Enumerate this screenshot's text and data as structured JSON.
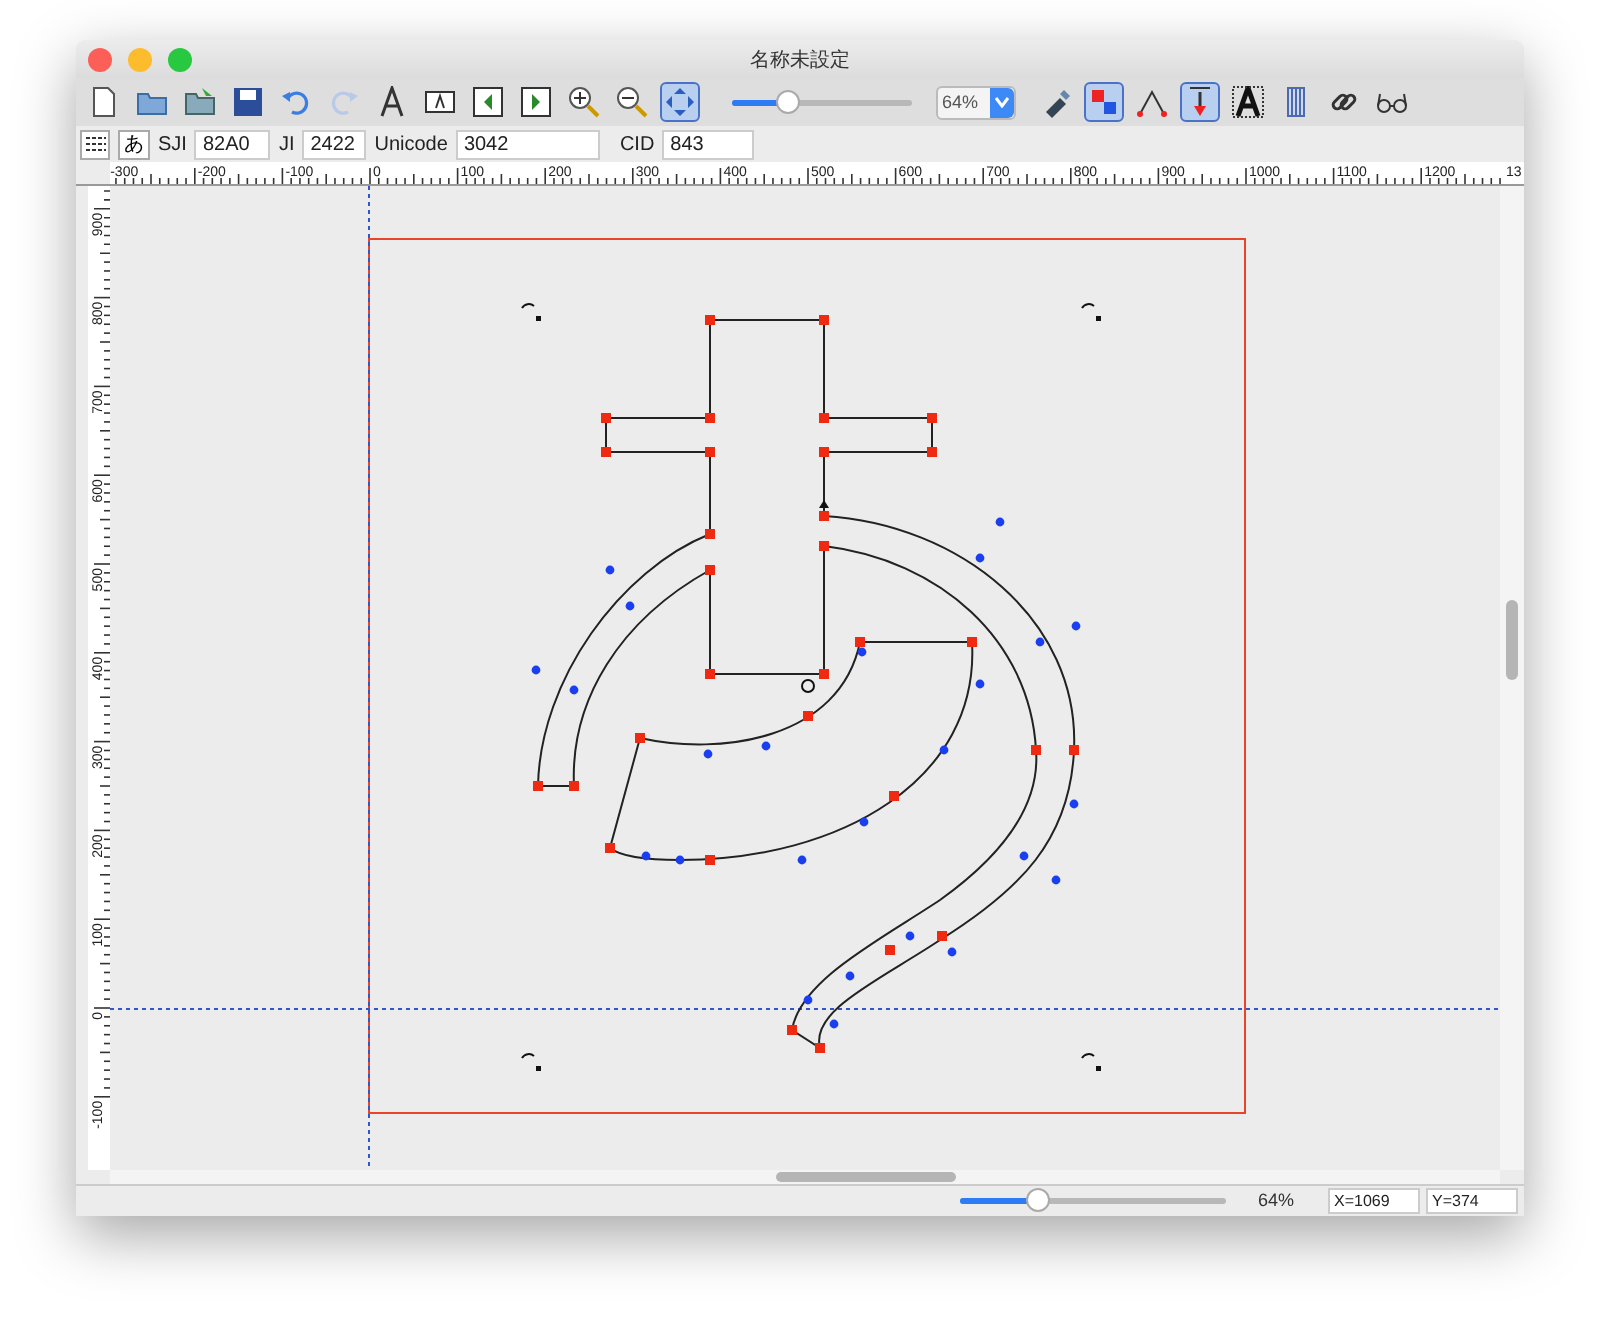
{
  "window": {
    "title": "名称未設定"
  },
  "toolbar": {
    "left_tools": [
      {
        "kind": "new",
        "pressed": false
      },
      {
        "kind": "open",
        "pressed": false
      },
      {
        "kind": "import",
        "pressed": false
      },
      {
        "kind": "save",
        "pressed": false
      },
      {
        "kind": "undo",
        "pressed": false
      },
      {
        "kind": "redo",
        "pressed": false
      },
      {
        "kind": "font",
        "pressed": false
      },
      {
        "kind": "char",
        "pressed": false
      },
      {
        "kind": "prev",
        "pressed": false
      },
      {
        "kind": "next",
        "pressed": false
      },
      {
        "kind": "zoomin",
        "pressed": false
      },
      {
        "kind": "zoomout",
        "pressed": false
      },
      {
        "kind": "fit",
        "pressed": true
      }
    ],
    "zoom_slider": {
      "level": 0.31
    },
    "zoom_select": {
      "value": "64%"
    },
    "right_tools": [
      {
        "kind": "pen",
        "pressed": false
      },
      {
        "kind": "points",
        "pressed": true
      },
      {
        "kind": "angle",
        "pressed": false
      },
      {
        "kind": "down",
        "pressed": true
      },
      {
        "kind": "outline",
        "pressed": false
      },
      {
        "kind": "grid",
        "pressed": false
      },
      {
        "kind": "link",
        "pressed": false
      },
      {
        "kind": "glasses",
        "pressed": false
      }
    ]
  },
  "info_bar": {
    "glyph": "あ",
    "fields": [
      {
        "label": "SJI",
        "value": "82A0"
      },
      {
        "label": "JI",
        "value": "2422"
      },
      {
        "label": "Unicode",
        "value": "3042"
      },
      {
        "label": "CID",
        "value": "843"
      }
    ]
  },
  "rulers": {
    "horizontal": [
      "-300",
      "-200",
      "-100",
      "0",
      "100",
      "200",
      "300",
      "400",
      "500",
      "600",
      "700",
      "800",
      "900",
      "1000",
      "1100",
      "1200",
      "13"
    ],
    "vertical": [
      "900",
      "800",
      "700",
      "600",
      "500",
      "400",
      "300",
      "200",
      "100",
      "0",
      "-100"
    ]
  },
  "status_bar": {
    "zoom_slider": {
      "level": 0.29
    },
    "zoom": "64%",
    "x": "X=1069",
    "y": "Y=374"
  }
}
